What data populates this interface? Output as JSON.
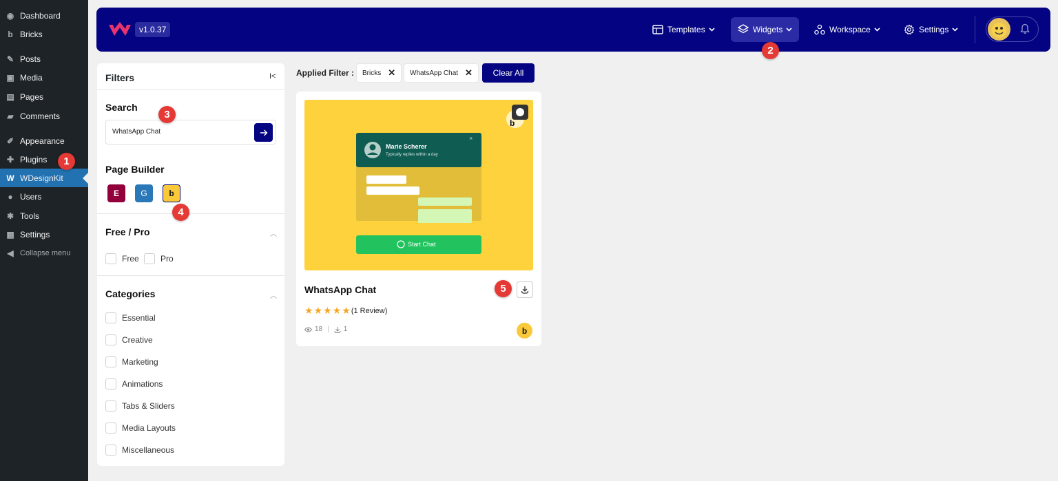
{
  "wp_menu": [
    {
      "label": "Dashboard",
      "icon": "dashboard-icon",
      "glyph": "◉"
    },
    {
      "label": "Bricks",
      "icon": "bricks-icon",
      "glyph": "b"
    },
    {
      "label": "Posts",
      "icon": "pin-icon",
      "glyph": "✎"
    },
    {
      "label": "Media",
      "icon": "media-icon",
      "glyph": "▣"
    },
    {
      "label": "Pages",
      "icon": "pages-icon",
      "glyph": "▤"
    },
    {
      "label": "Comments",
      "icon": "comments-icon",
      "glyph": "▰"
    },
    {
      "label": "Appearance",
      "icon": "brush-icon",
      "glyph": "✐"
    },
    {
      "label": "Plugins",
      "icon": "plug-icon",
      "glyph": "✚"
    },
    {
      "label": "WDesignKit",
      "icon": "wdesignkit-icon",
      "glyph": "W"
    },
    {
      "label": "Users",
      "icon": "user-icon",
      "glyph": "●"
    },
    {
      "label": "Tools",
      "icon": "wrench-icon",
      "glyph": "✱"
    },
    {
      "label": "Settings",
      "icon": "settings-icon",
      "glyph": "▦"
    },
    {
      "label": "Collapse menu",
      "icon": "collapse-icon",
      "glyph": "◀"
    }
  ],
  "header": {
    "version": "v1.0.37",
    "nav": {
      "templates": "Templates",
      "widgets": "Widgets",
      "workspace": "Workspace",
      "settings": "Settings"
    }
  },
  "filters": {
    "title": "Filters",
    "collapse_glyph": "I<",
    "search": {
      "title": "Search",
      "value": "WhatsApp Chat"
    },
    "page_builder": {
      "title": "Page Builder",
      "elementor": "E",
      "gutenberg": "G",
      "bricks": "b"
    },
    "free_pro": {
      "title": "Free / Pro",
      "options": [
        "Free",
        "Pro"
      ]
    },
    "categories": {
      "title": "Categories",
      "options": [
        "Essential",
        "Creative",
        "Marketing",
        "Animations",
        "Tabs & Sliders",
        "Media Layouts",
        "Miscellaneous"
      ]
    }
  },
  "applied": {
    "label": "Applied Filter :",
    "chips": [
      "Bricks",
      "WhatsApp Chat"
    ],
    "clear_all": "Clear All"
  },
  "card": {
    "title": "WhatsApp Chat",
    "reviews": "(1 Review)",
    "rating": 5,
    "views": "18",
    "downloads": "1",
    "builder_badge": "b",
    "preview": {
      "name": "Marie Scherer",
      "subtitle": "Typically replies within a day",
      "button": "Start Chat",
      "badge_letter": "b",
      "close_glyph": "×"
    }
  },
  "badges": [
    "1",
    "2",
    "3",
    "4",
    "5"
  ],
  "colors": {
    "brand": "#040482",
    "wp_sidebar": "#1d2327",
    "wp_active": "#2271b1",
    "annotation": "#e53935",
    "card_bg": "#fdd23c"
  }
}
